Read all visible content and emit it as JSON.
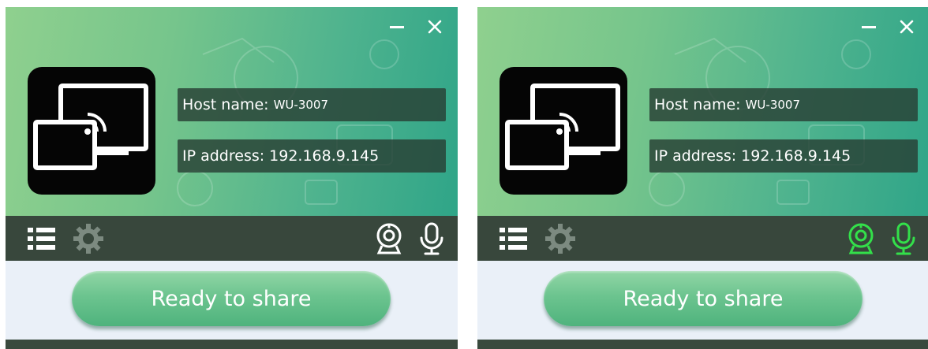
{
  "panels": [
    {
      "id": "left",
      "host_label": "Host name:",
      "host_value": "WU-3007",
      "ip_label": "IP address:",
      "ip_value": "192.168.9.145",
      "share_label": "Ready to share",
      "camera_active": false,
      "mic_active": false
    },
    {
      "id": "right",
      "host_label": "Host name:",
      "host_value": "WU-3007",
      "ip_label": "IP address:",
      "ip_value": "192.168.9.145",
      "share_label": "Ready to share",
      "camera_active": true,
      "mic_active": true
    }
  ],
  "icons": {
    "minimize": "minimize-icon",
    "close": "close-icon",
    "logo": "screen-cast-icon",
    "menu": "list-icon",
    "settings": "gear-icon",
    "camera": "webcam-icon",
    "microphone": "microphone-icon"
  },
  "colors": {
    "toolbar_bg": "#38473c",
    "icon_inactive": "#ffffff",
    "icon_active": "#33e04a",
    "share_green": "#6cc48f"
  }
}
